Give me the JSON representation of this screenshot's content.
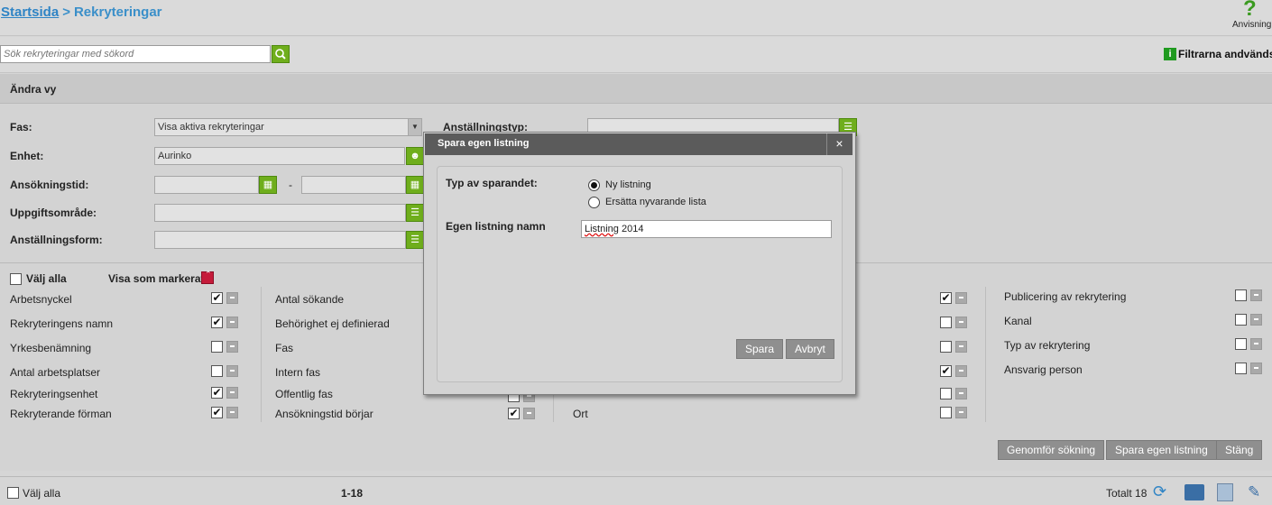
{
  "breadcrumb": {
    "home": "Startsida",
    "separator": ">",
    "current": "Rekryteringar"
  },
  "help": {
    "label": "Anvisning",
    "icon": "question-icon"
  },
  "search": {
    "placeholder": "Sök rekryteringar med sökord",
    "icon": "search-icon"
  },
  "filter_notice": "Filtrarna andvänds",
  "panel": {
    "title": "Ändra vy",
    "fields": {
      "fas": {
        "label": "Fas:",
        "value": "Visa aktiva rekryteringar"
      },
      "enhet": {
        "label": "Enhet:",
        "value": "Aurinko"
      },
      "ansokningstid": {
        "label": "Ansökningstid:",
        "from": "",
        "to": "",
        "dash": "-"
      },
      "uppgiftsomrade": {
        "label": "Uppgiftsområde:",
        "value": ""
      },
      "anstallningsform": {
        "label": "Anställningsform:",
        "value": ""
      },
      "anstallningstyp": {
        "label": "Anställningstyp:",
        "value": ""
      }
    },
    "select_all": "Välj alla",
    "show_marked": "Visa som markerat",
    "col1": [
      {
        "label": "Arbetsnyckel",
        "checked": true
      },
      {
        "label": "Rekryteringens namn",
        "checked": true
      },
      {
        "label": "Yrkesbenämning",
        "checked": false
      },
      {
        "label": "Antal arbetsplatser",
        "checked": false
      },
      {
        "label": "Rekryteringsenhet",
        "checked": true
      },
      {
        "label": "Rekryterande förman",
        "checked": true
      }
    ],
    "col2": [
      {
        "label": "Antal sökande"
      },
      {
        "label": "Behörighet ej definierad"
      },
      {
        "label": "Fas"
      },
      {
        "label": "Intern fas"
      },
      {
        "label": "Offentlig fas"
      },
      {
        "label": "Ansökningstid börjar",
        "checked": true
      }
    ],
    "col3": [
      {
        "checked": true
      },
      {
        "checked": false
      },
      {
        "checked": false
      },
      {
        "checked": true
      },
      {
        "checked": false
      },
      {
        "label": "Ort",
        "checked": false
      }
    ],
    "col4": [
      {
        "label": "Publicering av rekrytering",
        "checked": false
      },
      {
        "label": "Kanal",
        "checked": false
      },
      {
        "label": "Typ av rekrytering",
        "checked": false
      },
      {
        "label": "Ansvarig person",
        "checked": false
      }
    ],
    "buttons": {
      "search": "Genomför sökning",
      "save_list": "Spara egen listning",
      "close": "Stäng"
    }
  },
  "footer": {
    "select_all": "Välj alla",
    "range": "1-18",
    "total": "Totalt 18"
  },
  "modal": {
    "title": "Spara egen listning",
    "close": "×",
    "type_label": "Typ av sparandet:",
    "options": [
      {
        "label": "Ny listning",
        "selected": true
      },
      {
        "label": "Ersätta nyvarande lista",
        "selected": false
      }
    ],
    "name_label": "Egen listning namn",
    "name_value_word": "Listning",
    "name_value_rest": " 2014",
    "save": "Spara",
    "cancel": "Avbryt"
  },
  "colors": {
    "accent_green": "#6fae1c",
    "link_blue": "#2f84c5",
    "modal_header": "#5b5b5b",
    "button_gray": "#8f8f8f",
    "marker_red": "#c51b3a"
  }
}
